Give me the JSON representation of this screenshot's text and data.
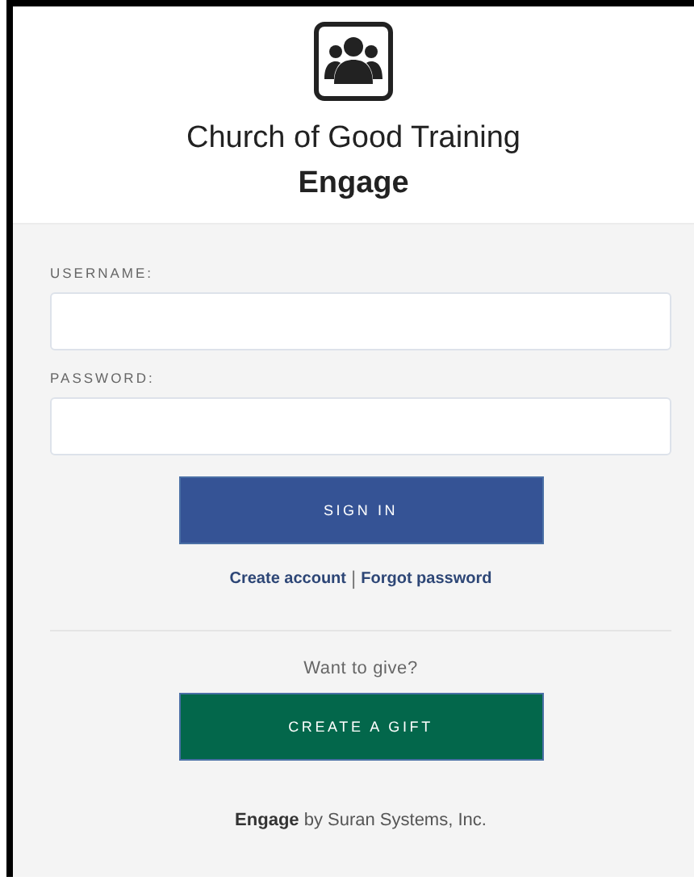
{
  "header": {
    "organization": "Church of Good Training",
    "app_name": "Engage"
  },
  "form": {
    "fields": [
      {
        "label": "USERNAME:"
      },
      {
        "label": "PASSWORD:"
      }
    ],
    "sign_in_button": "SIGN IN",
    "links": [
      "Create account",
      "Forgot password"
    ],
    "link_separator": "|"
  },
  "give": {
    "prompt": "Want to give?",
    "button": "CREATE A GIFT"
  },
  "footer": "**Engage** by Suran Systems, Inc."
}
